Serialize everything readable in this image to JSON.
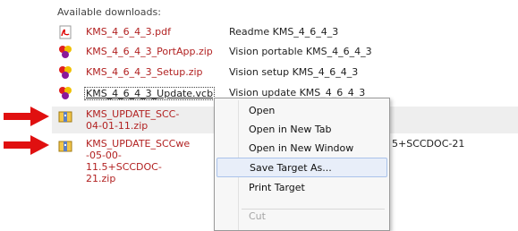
{
  "heading": "Available downloads:",
  "downloads": [
    {
      "icon": "pdf-icon",
      "name": "KMS_4_6_4_3.pdf",
      "description": "Readme KMS_4_6_4_3"
    },
    {
      "icon": "vision-app-icon",
      "name": "KMS_4_6_4_3_PortApp.zip",
      "description": "Vision portable KMS_4_6_4_3"
    },
    {
      "icon": "vision-app-icon",
      "name": "KMS_4_6_4_3_Setup.zip",
      "description": "Vision setup KMS_4_6_4_3"
    },
    {
      "icon": "vision-app-icon",
      "name": "KMS_4_6_4_3_Update.vcb",
      "description": "Vision update KMS_4_6_4_3"
    },
    {
      "icon": "archive-icon",
      "name_lines": [
        "KMS_UPDATE_SCC-",
        "04-01-11.zip"
      ],
      "description": ""
    },
    {
      "icon": "archive-icon",
      "name_lines": [
        "KMS_UPDATE_SCCwe",
        "-05-00-",
        "11.5+SCCDOC-",
        "21.zip"
      ],
      "description": "5+SCCDOC-21"
    }
  ],
  "context_menu": {
    "items": [
      "Open",
      "Open in New Tab",
      "Open in New Window",
      "Save Target As...",
      "Print Target",
      "Cut"
    ],
    "highlighted": "Save Target As...",
    "disabled": [
      "Cut"
    ]
  },
  "colors": {
    "link": "#b22222",
    "arrow": "#e01010",
    "menu_highlight": "#e8eef9"
  }
}
